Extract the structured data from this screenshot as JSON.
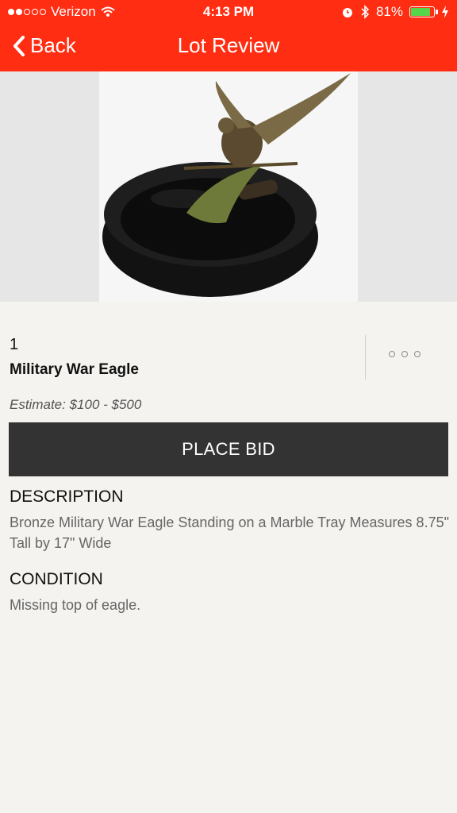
{
  "status": {
    "carrier": "Verizon",
    "time": "4:13 PM",
    "battery": "81%",
    "battery_level": 0.81,
    "signal_bars_filled": 2
  },
  "nav": {
    "back_label": "Back",
    "title": "Lot Review"
  },
  "lot": {
    "number": "1",
    "title": "Military War Eagle",
    "estimate": "Estimate: $100 - $500"
  },
  "actions": {
    "place_bid_label": "PLACE BID"
  },
  "description": {
    "heading": "DESCRIPTION",
    "text": "Bronze Military War Eagle Standing on a Marble Tray Measures 8.75\" Tall by 17\" Wide"
  },
  "condition": {
    "heading": "CONDITION",
    "text": "Missing top of eagle."
  },
  "colors": {
    "brand": "#ff2d12",
    "button": "#333333",
    "background": "#f4f3ef"
  }
}
